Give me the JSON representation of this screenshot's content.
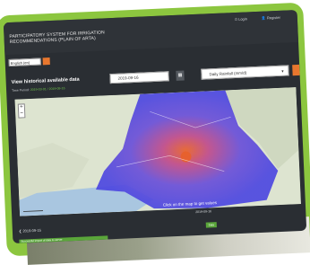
{
  "app": {
    "title": "PARTICIPATORY SYSTEM FOR IRRIGATION RECOMMENDATIONS (PLAIN OF ARTA)",
    "login_label": "Login",
    "register_label": "Register"
  },
  "language": {
    "selected": "English (en)"
  },
  "history": {
    "title": "View historical available data",
    "time_period_label": "Time Period:",
    "time_period_value": "2019-03-01 / 2019-09-16"
  },
  "date_input": {
    "value": "2019-09-16"
  },
  "variable_select": {
    "selected": "Daily Rainfall (mm/d)"
  },
  "map": {
    "click_hint": "Click on the map to get values",
    "date": "2019-09-16",
    "zoom_in": "+",
    "zoom_out": "−"
  },
  "nav": {
    "prev_label": "❮ 2019-09-15",
    "badge": "Data"
  },
  "status": {
    "text": "Successful import of data to server"
  },
  "colors": {
    "frame_green": "#8cc63f",
    "accent_orange": "#e8772e",
    "rainfall_blue": "#4d47e0",
    "rainfall_center": "#e8602a"
  },
  "icons": {
    "login": "login-icon",
    "register": "user-icon",
    "calendar": "calendar-icon",
    "dropdown": "chevron-down-icon"
  }
}
